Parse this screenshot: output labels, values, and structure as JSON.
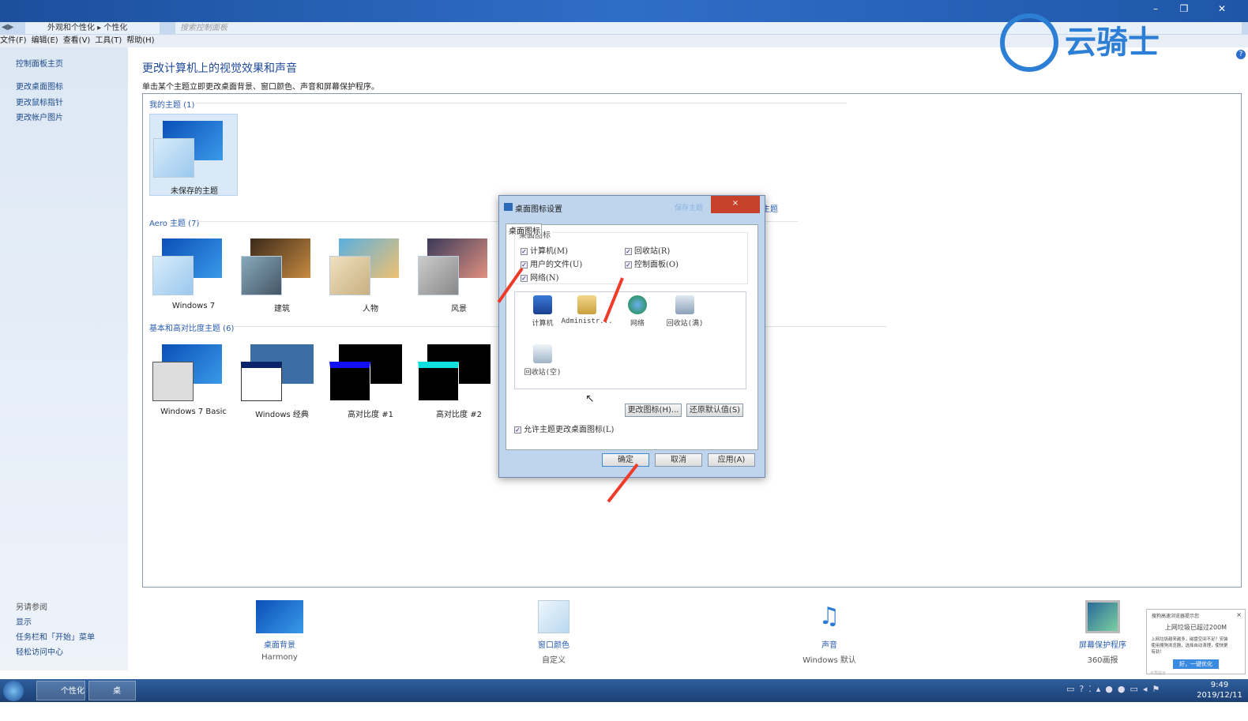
{
  "window": {
    "controls": [
      "minimize",
      "restore",
      "close"
    ]
  },
  "address": {
    "breadcrumb": [
      "外观和个性化",
      "个性化"
    ],
    "search_placeholder": "搜索控制面板"
  },
  "menu": [
    "文件(F)",
    "编辑(E)",
    "查看(V)",
    "工具(T)",
    "帮助(H)"
  ],
  "sidebar": {
    "home": "控制面板主页",
    "links": [
      "更改桌面图标",
      "更改鼠标指针",
      "更改帐户图片"
    ],
    "see_also": "另请参阅",
    "see_also_links": [
      "显示",
      "任务栏和「开始」菜单",
      "轻松访问中心"
    ]
  },
  "main": {
    "title": "更改计算机上的视觉效果和声音",
    "subtitle": "单击某个主题立即更改桌面背景、窗口颜色、声音和屏幕保护程序。",
    "my_themes": {
      "label": "我的主题 (1)",
      "items": [
        "未保存的主题"
      ]
    },
    "aero": {
      "label": "Aero 主题 (7)",
      "items": [
        "Windows 7",
        "建筑",
        "人物",
        "风景"
      ]
    },
    "basic": {
      "label": "基本和高对比度主题 (6)",
      "items": [
        "Windows 7 Basic",
        "Windows 经典",
        "高对比度 #1",
        "高对比度 #2"
      ]
    },
    "save_theme_link": "保存主题",
    "online_link": "主题"
  },
  "bottom": [
    {
      "label": "桌面背景",
      "value": "Harmony"
    },
    {
      "label": "窗口颜色",
      "value": "自定义"
    },
    {
      "label": "声音",
      "value": "Windows 默认"
    },
    {
      "label": "屏幕保护程序",
      "value": "360画报"
    }
  ],
  "dialog": {
    "title": "桌面图标设置",
    "close": "×",
    "tab": "桌面图标",
    "group": "桌面图标",
    "checks": [
      {
        "label": "计算机(M)",
        "checked": true
      },
      {
        "label": "用户的文件(U)",
        "checked": true
      },
      {
        "label": "网络(N)",
        "checked": true
      },
      {
        "label": "回收站(R)",
        "checked": true
      },
      {
        "label": "控制面板(O)",
        "checked": true
      }
    ],
    "icons": [
      "计算机",
      "Administr...",
      "网络",
      "回收站(满)",
      "回收站(空)"
    ],
    "change_icon": "更改图标(H)...",
    "restore_default": "还原默认值(S)",
    "allow_themes": "允许主题更改桌面图标(L)",
    "allow_checked": true,
    "ok": "确定",
    "cancel": "取消",
    "apply": "应用(A)"
  },
  "watermark": "云骑士",
  "notification": {
    "app": "搜狗高速浏览器提示您",
    "title": "上网垃圾已超过200M",
    "body": "上网垃圾越来越多，磁盘空间不足？安装使用搜狗浏览器，选择自动清理，使快更有劲！",
    "button": "好，一键优化",
    "dismiss": "不再提示",
    "close": "×"
  },
  "taskbar": {
    "items": [
      "个性化",
      "桌面..."
    ],
    "time": "9:49",
    "date": "2019/12/11"
  },
  "colors": {
    "accent": "#2a5db0",
    "close_red": "#c7402a",
    "arrow": "#f03a2a"
  }
}
